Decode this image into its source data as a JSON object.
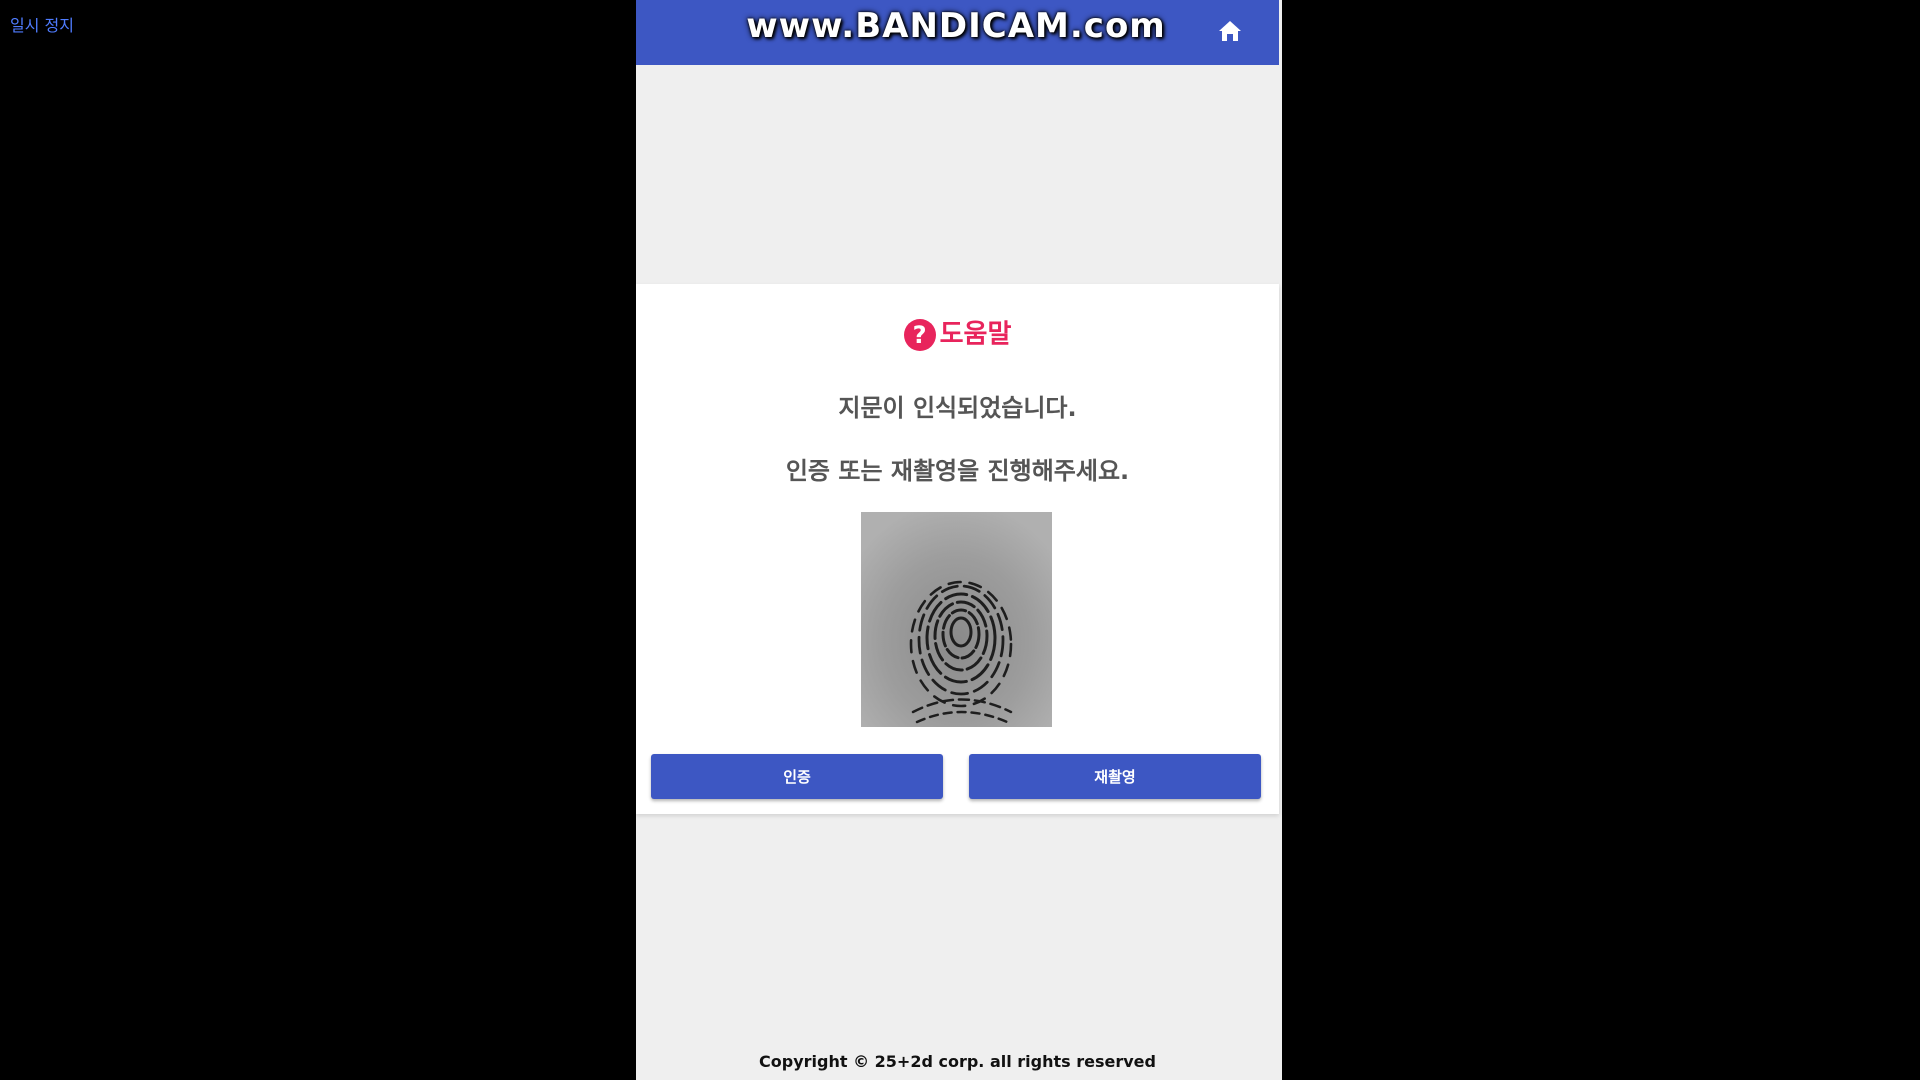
{
  "player": {
    "pause_label": "일시 정지"
  },
  "header": {
    "watermark": "www.BANDICAM.com",
    "home_icon": "home-icon",
    "background": "#3d57c3"
  },
  "dialog": {
    "title": "도움말",
    "title_icon": "question-circle-icon",
    "title_color": "#e8245c",
    "message_line1": "지문이 인식되었습니다.",
    "message_line2": "인증 또는 재촬영을 진행해주세요.",
    "image": "fingerprint-image",
    "buttons": {
      "auth_label": "인증",
      "retake_label": "재촬영"
    }
  },
  "footer": {
    "copyright": "Copyright © 25+2d corp. all rights reserved"
  }
}
